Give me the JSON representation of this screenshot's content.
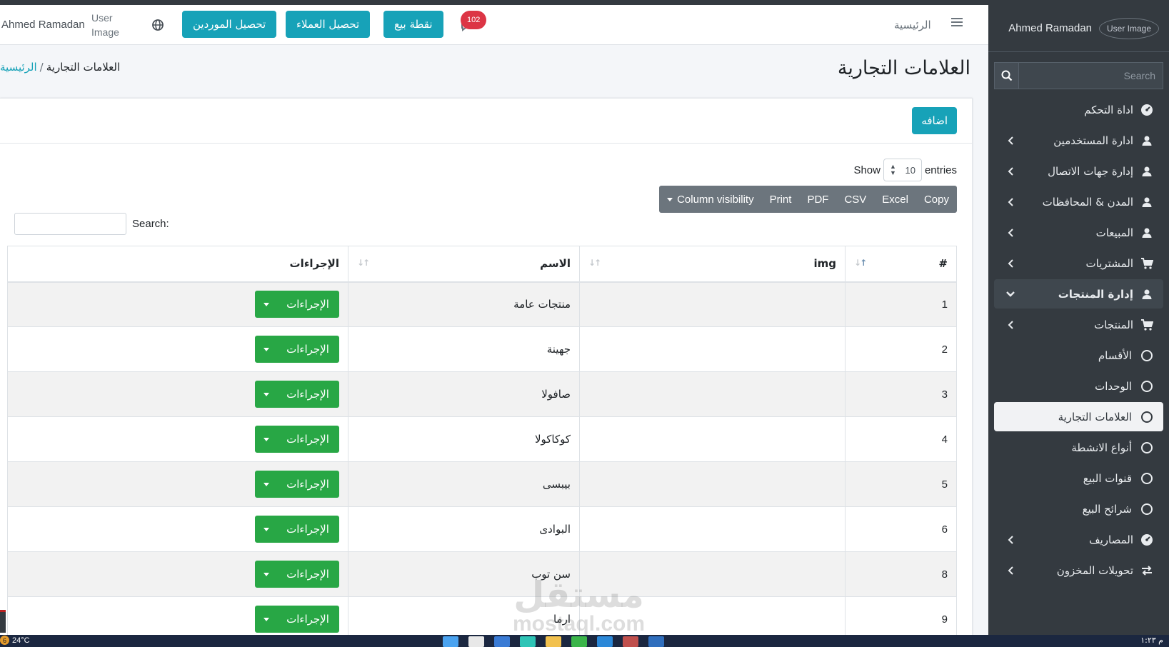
{
  "sidebar": {
    "user_name": "Ahmed Ramadan",
    "user_image_alt": "User Image",
    "search_placeholder": "Search",
    "items": [
      {
        "label": "اداة التحكم",
        "icon": "dashboard-icon",
        "chevron": false,
        "state": "normal"
      },
      {
        "label": "ادارة المستخدمين",
        "icon": "user-icon",
        "chevron": true,
        "state": "normal"
      },
      {
        "label": "إدارة جهات الاتصال",
        "icon": "user-icon",
        "chevron": true,
        "state": "normal"
      },
      {
        "label": "المدن & المحافظات",
        "icon": "user-icon",
        "chevron": true,
        "state": "normal"
      },
      {
        "label": "المبيعات",
        "icon": "user-icon",
        "chevron": true,
        "state": "normal"
      },
      {
        "label": "المشتريات",
        "icon": "cart-icon",
        "chevron": true,
        "state": "normal"
      },
      {
        "label": "إدارة المنتجات",
        "icon": "user-icon",
        "chevron": true,
        "state": "open"
      },
      {
        "label": "المنتجات",
        "icon": "cart-icon",
        "chevron": true,
        "state": "normal"
      },
      {
        "label": "الأقسام",
        "icon": "circle-icon",
        "chevron": false,
        "state": "normal"
      },
      {
        "label": "الوحدات",
        "icon": "circle-icon",
        "chevron": false,
        "state": "normal"
      },
      {
        "label": "العلامات التجارية",
        "icon": "circle-icon",
        "chevron": false,
        "state": "active"
      },
      {
        "label": "أنواع الانشطة",
        "icon": "circle-icon",
        "chevron": false,
        "state": "normal"
      },
      {
        "label": "قنوات البيع",
        "icon": "circle-icon",
        "chevron": false,
        "state": "normal"
      },
      {
        "label": "شرائح البيع",
        "icon": "circle-icon",
        "chevron": false,
        "state": "normal"
      },
      {
        "label": "المصاريف",
        "icon": "dashboard-icon",
        "chevron": true,
        "state": "normal"
      },
      {
        "label": "تحويلات المخزون",
        "icon": "transfer-icon",
        "chevron": true,
        "state": "normal"
      }
    ]
  },
  "navbar": {
    "home_label": "الرئيسية",
    "notification_count": "102",
    "buttons": {
      "pos": "نقطة بيع",
      "customer_collection": "تحصيل العملاء",
      "supplier_collection": "تحصيل الموردين"
    },
    "user_image_alt": "User Image",
    "user_name": "Ahmed Ramadan"
  },
  "page": {
    "title": "العلامات التجارية",
    "breadcrumb_home": "الرئيسية",
    "breadcrumb_current": "العلامات التجارية"
  },
  "card": {
    "add_label": "اضافه",
    "show_label": "Show",
    "entries_value": "10",
    "entries_label": "entries",
    "export_buttons": [
      "Copy",
      "Excel",
      "CSV",
      "PDF",
      "Print"
    ],
    "column_visibility": "Column visibility",
    "search_label": "Search:"
  },
  "table": {
    "headers": [
      "#",
      "img",
      "الاسم",
      "الإجراءات"
    ],
    "action_label": "الإجراءات",
    "rows": [
      {
        "num": "1",
        "name": "منتجات عامة"
      },
      {
        "num": "2",
        "name": "جهينة"
      },
      {
        "num": "3",
        "name": "صافولا"
      },
      {
        "num": "4",
        "name": "كوكاكولا"
      },
      {
        "num": "5",
        "name": "بيبسى"
      },
      {
        "num": "6",
        "name": "البوادى"
      },
      {
        "num": "8",
        "name": "سن توب"
      },
      {
        "num": "9",
        "name": "ارما"
      }
    ]
  },
  "watermark": {
    "line1": "مستقل",
    "line2": "mostaql.com"
  },
  "taskbar": {
    "weather_badge": "6",
    "temperature": "24°C",
    "clock": "م ١:٢٣"
  },
  "colors": {
    "sidebar_bg": "#343a40",
    "primary": "#17a2b8",
    "success": "#28a745",
    "danger": "#dc3545",
    "secondary": "#6c757d"
  }
}
